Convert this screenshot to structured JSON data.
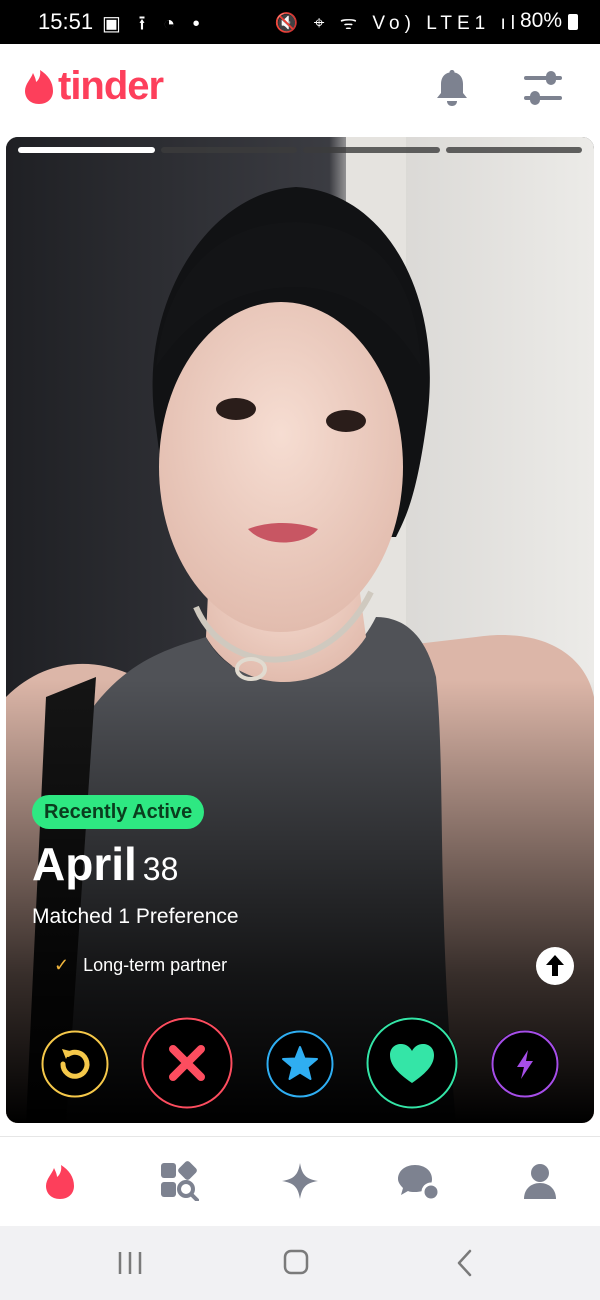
{
  "status_bar": {
    "time": "15:51",
    "left_icons": "▣ ⭱ ◔ •",
    "right_icons": "🔇 ⌖ ᯤ Vo) LTE1 ıl",
    "battery": "80%"
  },
  "header": {
    "logo_text": "tinder",
    "brand_color": "#fd3f5b"
  },
  "card": {
    "photo_count": 4,
    "active_photo": 1,
    "badge": "Recently Active",
    "name": "April",
    "age": "38",
    "matched_text": "Matched 1 Preference",
    "preference": "Long-term partner"
  },
  "actions": [
    {
      "name": "rewind",
      "color": "#f5c84a"
    },
    {
      "name": "nope",
      "color": "#fd4d5f"
    },
    {
      "name": "super-like",
      "color": "#2faef2"
    },
    {
      "name": "like",
      "color": "#34e5a7"
    },
    {
      "name": "boost",
      "color": "#a64ee8"
    }
  ],
  "tabs": [
    "home",
    "explore",
    "gold",
    "messages",
    "profile"
  ]
}
